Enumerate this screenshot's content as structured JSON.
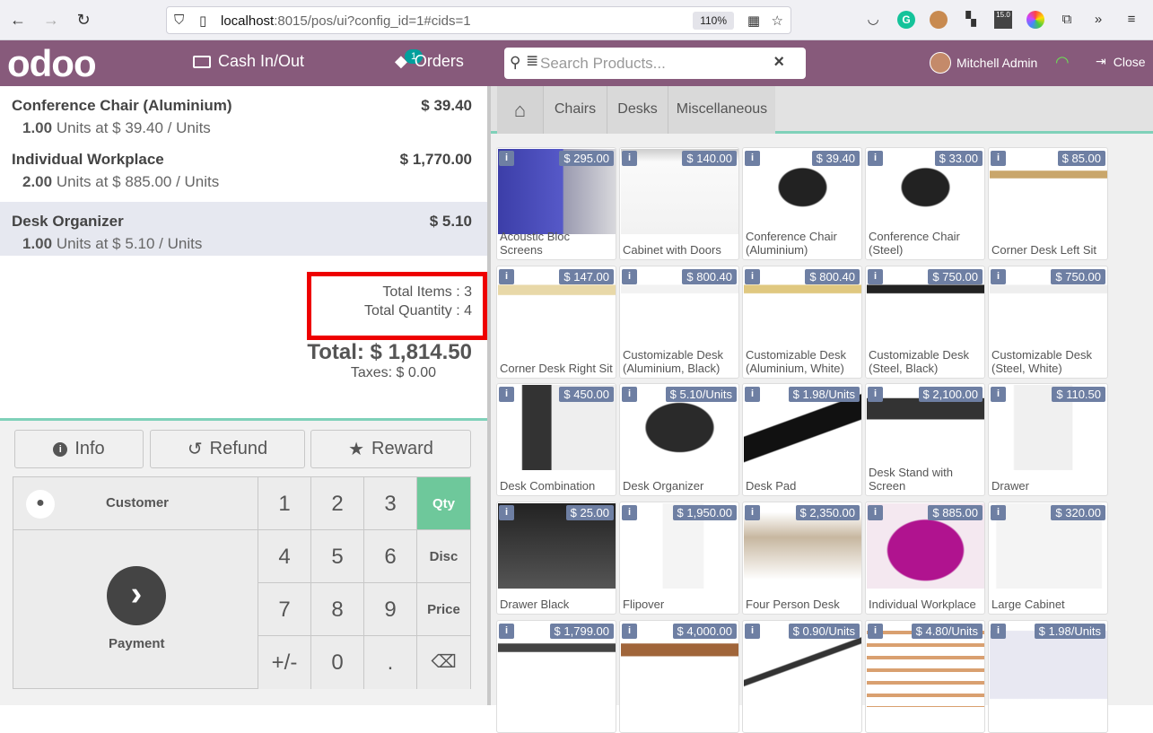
{
  "browser": {
    "url_host": "localhost",
    "url_rest": ":8015/pos/ui?config_id=1#cids=1",
    "zoom": "110%",
    "ext_badge": "15.0"
  },
  "header": {
    "cash_label": "Cash In/Out",
    "orders_label": "Orders",
    "orders_count": "1",
    "search_placeholder": "Search Products...",
    "user_name": "Mitchell Admin",
    "close_label": "Close"
  },
  "order": {
    "lines": [
      {
        "name": "Conference Chair (Aluminium)",
        "price": "$ 39.40",
        "qty": "1.00",
        "info": "Units at $ 39.40 / Units"
      },
      {
        "name": "Individual Workplace",
        "price": "$ 1,770.00",
        "qty": "2.00",
        "info": "Units at $ 885.00 / Units"
      },
      {
        "name": "Desk Organizer",
        "price": "$ 5.10",
        "qty": "1.00",
        "info": "Units at $ 5.10 / Units"
      }
    ],
    "total_items": "Total Items : 3",
    "total_quantity": "Total Quantity : 4",
    "total": "Total: $ 1,814.50",
    "taxes": "Taxes: $ 0.00"
  },
  "controls": {
    "info": "Info",
    "refund": "Refund",
    "reward": "Reward",
    "customer": "Customer",
    "payment": "Payment",
    "keys": [
      "1",
      "2",
      "3",
      "4",
      "5",
      "6",
      "7",
      "8",
      "9",
      "+/-",
      "0",
      "."
    ],
    "modes": [
      "Qty",
      "Disc",
      "Price"
    ]
  },
  "categories": [
    "Chairs",
    "Desks",
    "Miscellaneous"
  ],
  "products": [
    {
      "name": "Acoustic Bloc Screens",
      "price": "$ 295.00"
    },
    {
      "name": "Cabinet with Doors",
      "price": "$ 140.00"
    },
    {
      "name": "Conference Chair (Aluminium)",
      "price": "$ 39.40"
    },
    {
      "name": "Conference Chair (Steel)",
      "price": "$ 33.00"
    },
    {
      "name": "Corner Desk Left Sit",
      "price": "$ 85.00"
    },
    {
      "name": "Corner Desk Right Sit",
      "price": "$ 147.00"
    },
    {
      "name": "Customizable Desk (Aluminium, Black)",
      "price": "$ 800.40"
    },
    {
      "name": "Customizable Desk (Aluminium, White)",
      "price": "$ 800.40"
    },
    {
      "name": "Customizable Desk (Steel, Black)",
      "price": "$ 750.00"
    },
    {
      "name": "Customizable Desk (Steel, White)",
      "price": "$ 750.00"
    },
    {
      "name": "Desk Combination",
      "price": "$ 450.00"
    },
    {
      "name": "Desk Organizer",
      "price": "$ 5.10/Units"
    },
    {
      "name": "Desk Pad",
      "price": "$ 1.98/Units"
    },
    {
      "name": "Desk Stand with Screen",
      "price": "$ 2,100.00"
    },
    {
      "name": "Drawer",
      "price": "$ 110.50"
    },
    {
      "name": "Drawer Black",
      "price": "$ 25.00"
    },
    {
      "name": "Flipover",
      "price": "$ 1,950.00"
    },
    {
      "name": "Four Person Desk",
      "price": "$ 2,350.00"
    },
    {
      "name": "Individual Workplace",
      "price": "$ 885.00"
    },
    {
      "name": "Large Cabinet",
      "price": "$ 320.00"
    },
    {
      "name": "",
      "price": "$ 1,799.00"
    },
    {
      "name": "",
      "price": "$ 4,000.00"
    },
    {
      "name": "",
      "price": "$ 0.90/Units"
    },
    {
      "name": "",
      "price": "$ 4.80/Units"
    },
    {
      "name": "",
      "price": "$ 1.98/Units"
    }
  ]
}
